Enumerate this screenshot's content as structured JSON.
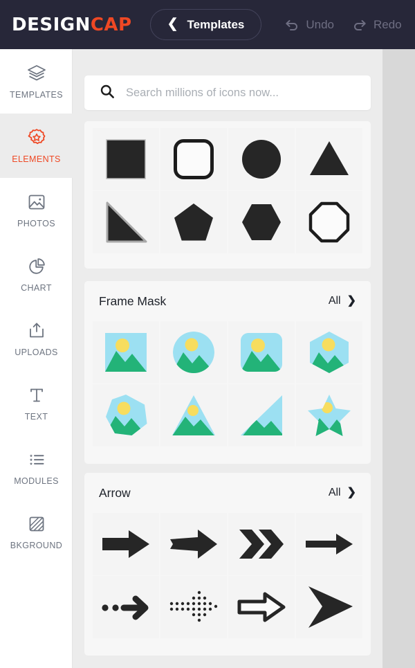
{
  "app": {
    "logo_part1": "DESIGN",
    "logo_part2": "CAP",
    "accent_color": "#ef4824",
    "topbar_bg": "#272739"
  },
  "topbar": {
    "templates_label": "Templates",
    "back_chevron": "chevron-left-icon",
    "undo_label": "Undo",
    "redo_label": "Redo"
  },
  "sidebar": {
    "items": [
      {
        "label": "TEMPLATES",
        "icon": "layers-icon",
        "active": false
      },
      {
        "label": "ELEMENTS",
        "icon": "badge-star-icon",
        "active": true
      },
      {
        "label": "PHOTOS",
        "icon": "image-icon",
        "active": false
      },
      {
        "label": "CHART",
        "icon": "pie-chart-icon",
        "active": false
      },
      {
        "label": "UPLOADS",
        "icon": "upload-icon",
        "active": false
      },
      {
        "label": "TEXT",
        "icon": "text-t-icon",
        "active": false
      },
      {
        "label": "MODULES",
        "icon": "list-star-icon",
        "active": false
      },
      {
        "label": "BKGROUND",
        "icon": "background-icon",
        "active": false
      }
    ]
  },
  "search": {
    "placeholder": "Search millions of icons now...",
    "value": "",
    "icon": "search-icon"
  },
  "sections": [
    {
      "id": "shapes",
      "title": "",
      "all_label": "",
      "show_header": false,
      "items": [
        {
          "name": "square-filled"
        },
        {
          "name": "rounded-square-outline"
        },
        {
          "name": "circle-filled"
        },
        {
          "name": "triangle-filled"
        },
        {
          "name": "right-triangle-filled"
        },
        {
          "name": "pentagon-filled"
        },
        {
          "name": "hexagon-filled"
        },
        {
          "name": "octagon-outline"
        }
      ]
    },
    {
      "id": "frame-mask",
      "title": "Frame Mask",
      "all_label": "All",
      "show_header": true,
      "items": [
        {
          "name": "frame-square"
        },
        {
          "name": "frame-circle"
        },
        {
          "name": "frame-rounded-square"
        },
        {
          "name": "frame-hexagon"
        },
        {
          "name": "frame-heptagon"
        },
        {
          "name": "frame-triangle"
        },
        {
          "name": "frame-right-triangle"
        },
        {
          "name": "frame-star"
        }
      ]
    },
    {
      "id": "arrow",
      "title": "Arrow",
      "all_label": "All",
      "show_header": true,
      "items": [
        {
          "name": "arrow-block-right"
        },
        {
          "name": "arrow-tapered-right"
        },
        {
          "name": "arrow-double-chevron-right"
        },
        {
          "name": "arrow-thin-right"
        },
        {
          "name": "arrow-dotted-lead-right"
        },
        {
          "name": "arrow-dot-matrix-right"
        },
        {
          "name": "arrow-outline-right"
        },
        {
          "name": "arrow-pointer-right"
        }
      ]
    }
  ],
  "colors": {
    "frame_sky": "#9ce0f2",
    "frame_mountain": "#23b378",
    "frame_sun": "#f7dd5e",
    "shape_dark": "#262626",
    "panel_bg": "#ececec",
    "card_bg": "#f7f7f7",
    "tile_bg": "#f4f4f4",
    "canvas_bg": "#d8d8d8"
  }
}
